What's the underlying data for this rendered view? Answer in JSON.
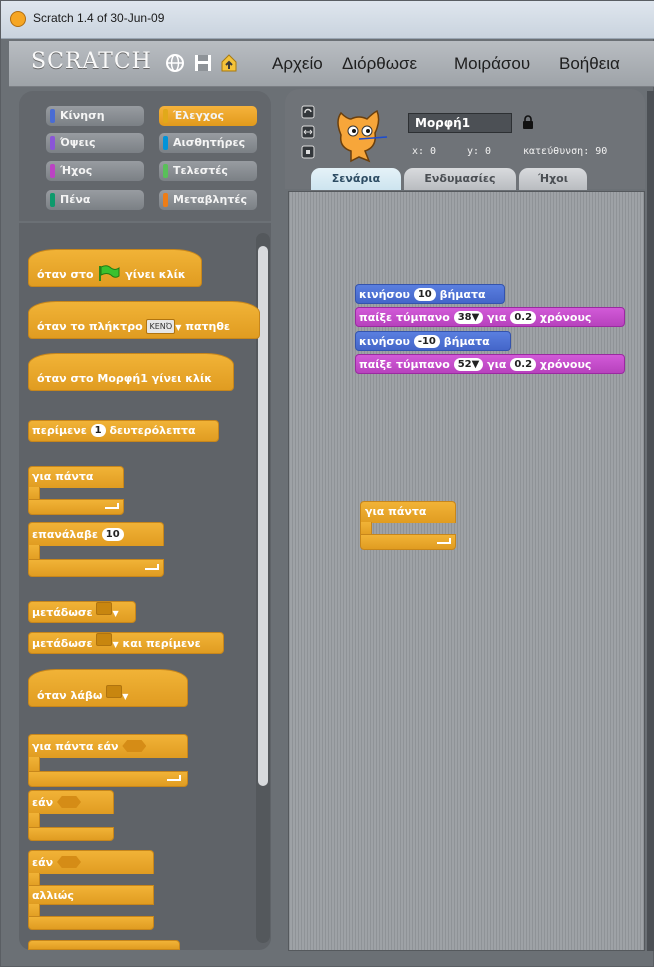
{
  "window": {
    "title": "Scratch 1.4 of 30-Jun-09",
    "icon": "scratch-cat-icon"
  },
  "menubar": {
    "logo": "SCRATCH",
    "icons": [
      "globe-icon",
      "save-icon",
      "share-icon"
    ],
    "menus": [
      "Αρχείο",
      "Διόρθωσε",
      "Μοιράσου",
      "Βοήθεια"
    ]
  },
  "categories": [
    {
      "label": "Κίνηση",
      "color": "#4a6cd4"
    },
    {
      "label": "Έλεγχος",
      "color": "#e1a91a",
      "selected": true
    },
    {
      "label": "Όψεις",
      "color": "#8a55d7"
    },
    {
      "label": "Αισθητήρες",
      "color": "#0093d9"
    },
    {
      "label": "Ήχος",
      "color": "#bb42c3"
    },
    {
      "label": "Τελεστές",
      "color": "#59c059"
    },
    {
      "label": "Πένα",
      "color": "#0e9a6c"
    },
    {
      "label": "Μεταβλητές",
      "color": "#ee7d16"
    }
  ],
  "palette": {
    "green_flag_prefix": "όταν στο",
    "green_flag_suffix": "γίνει κλίκ",
    "key_prefix": "όταν το πλήκτρο",
    "key_value": "ΚΕΝΌ",
    "key_suffix": "πατηθε",
    "sprite_click": "όταν στο Μορφή1 γίνει κλίκ",
    "wait_prefix": "περίμενε",
    "wait_value": "1",
    "wait_suffix": "δευτερόλεπτα",
    "forever": "για πάντα",
    "repeat": "επανάλαβε",
    "repeat_value": "10",
    "broadcast": "μετάδωσε",
    "broadcast_wait_suffix": "και περίμενε",
    "when_receive": "όταν λάβω",
    "forever_if": "για πάντα εάν",
    "if": "εάν",
    "if_else": "εάν",
    "else": "αλλιώς"
  },
  "sprite": {
    "name": "Μορφή1",
    "x_label": "x: 0",
    "y_label": "y: 0",
    "direction_label": "κατεύθυνση: 90",
    "rotation_icons": [
      "rotate-icon",
      "flip-icon",
      "no-rotate-icon"
    ]
  },
  "tabs": [
    {
      "label": "Σενάρια",
      "selected": true
    },
    {
      "label": "Ενδυμασίες"
    },
    {
      "label": "Ήχοι"
    }
  ],
  "scripts": {
    "move1_prefix": "κινήσου",
    "move1_value": "10",
    "move1_suffix": "βήματα",
    "drum1_prefix": "παίξε τύμπανο",
    "drum1_value": "38▼",
    "drum1_mid": "για",
    "drum1_beats": "0.2",
    "drum1_suffix": "χρόνους",
    "move2_prefix": "κινήσου",
    "move2_value": "-10",
    "move2_suffix": "βήματα",
    "drum2_prefix": "παίξε τύμπανο",
    "drum2_value": "52▼",
    "drum2_mid": "για",
    "drum2_beats": "0.2",
    "drum2_suffix": "χρόνους",
    "forever": "για πάντα"
  }
}
